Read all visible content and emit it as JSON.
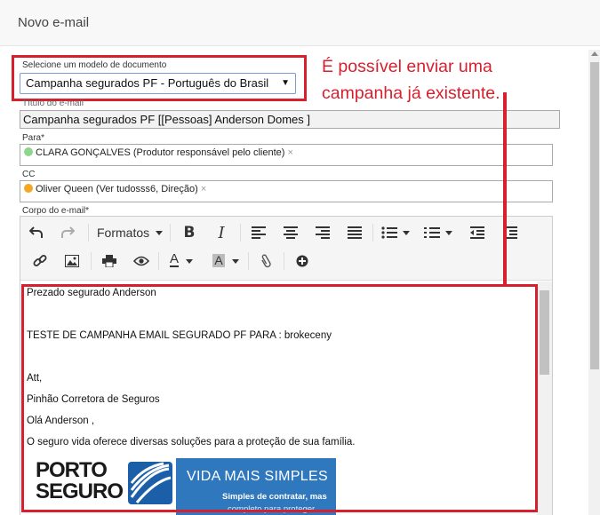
{
  "header": {
    "title": "Novo e-mail"
  },
  "template_select": {
    "label": "Selecione um modelo de documento",
    "value": "Campanha segurados PF - Português do Brasil",
    "caret": "▼"
  },
  "annotation": {
    "line1": "É possível enviar uma",
    "line2": "campanha já existente."
  },
  "subject": {
    "label": "Título do e-mail",
    "value": "Campanha segurados PF [[Pessoas] Anderson Domes ]"
  },
  "to": {
    "label": "Para*",
    "tag": {
      "text": "CLARA GONÇALVES (Produtor responsável pelo cliente)",
      "dot_color": "#8fd48f",
      "remove": "×"
    }
  },
  "cc": {
    "label": "CC",
    "tag": {
      "text": "Oliver Queen (Ver tudosss6, Direção)",
      "dot_color": "#f5a623",
      "remove": "×"
    }
  },
  "body": {
    "label": "Corpo do e-mail*",
    "toolbar": {
      "formats_label": "Formatos"
    },
    "lines": [
      "Prezado segurado Anderson",
      "TESTE DE CAMPANHA EMAIL SEGURADO PF PARA : brokeceny",
      "Att,",
      "Pinhão Corretora de Seguros",
      "Olá Anderson ,",
      " O seguro vida oferece diversas soluções para a proteção de sua família."
    ],
    "banner": {
      "logo_line1": "PORTO",
      "logo_line2": "SEGURO",
      "promo_title": "VIDA MAIS SIMPLES",
      "promo_sub1": "Simples de contratar, mas",
      "promo_sub2": "completo para proteger"
    }
  },
  "colors": {
    "highlight": "#d81f2e",
    "select_border": "#7a9cd3"
  }
}
